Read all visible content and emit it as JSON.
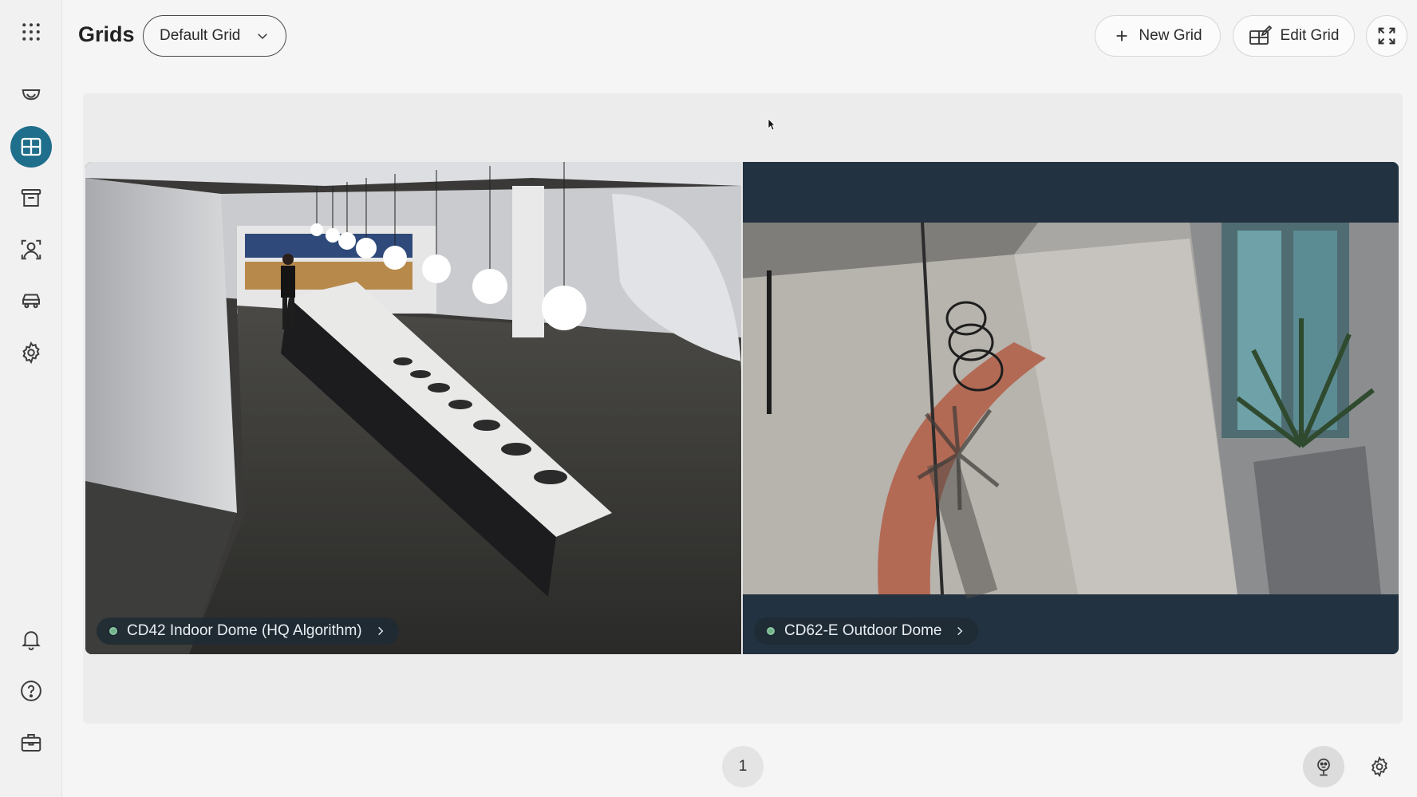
{
  "header": {
    "title": "Grids",
    "grid_select_value": "Default Grid",
    "new_grid_label": "New Grid",
    "edit_grid_label": "Edit Grid"
  },
  "sidebar": {
    "items": [
      {
        "name": "apps-grid-icon",
        "active": false
      },
      {
        "name": "camera-dome-icon",
        "active": false
      },
      {
        "name": "grids-icon",
        "active": true
      },
      {
        "name": "archive-icon",
        "active": false
      },
      {
        "name": "people-icon",
        "active": false
      },
      {
        "name": "vehicle-icon",
        "active": false
      },
      {
        "name": "settings-icon",
        "active": false
      },
      {
        "name": "bell-icon",
        "active": false
      },
      {
        "name": "help-icon",
        "active": false
      },
      {
        "name": "toolbox-icon",
        "active": false
      }
    ]
  },
  "tiles": [
    {
      "camera_name": "CD42 Indoor Dome (HQ Algorithm)",
      "status": "online"
    },
    {
      "camera_name": "CD62-E Outdoor Dome",
      "status": "online"
    }
  ],
  "pagination": {
    "current_page": "1"
  },
  "colors": {
    "accent": "#1f6e8c",
    "status_online": "#6fb38a"
  }
}
